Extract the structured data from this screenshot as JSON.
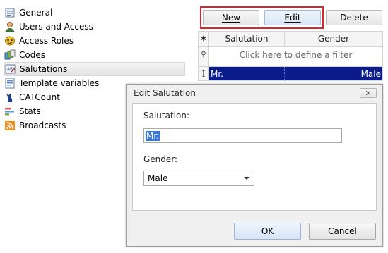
{
  "sidebar": {
    "items": [
      {
        "label": "General",
        "icon": "general-icon"
      },
      {
        "label": "Users and Access",
        "icon": "user-icon"
      },
      {
        "label": "Access Roles",
        "icon": "mask-icon"
      },
      {
        "label": "Codes",
        "icon": "codes-icon"
      },
      {
        "label": "Salutations",
        "icon": "salutation-icon",
        "selected": true
      },
      {
        "label": "Template variables",
        "icon": "template-icon"
      },
      {
        "label": "CATCount",
        "icon": "cat-icon"
      },
      {
        "label": "Stats",
        "icon": "stats-icon"
      },
      {
        "label": "Broadcasts",
        "icon": "rss-icon"
      }
    ]
  },
  "toolbar": {
    "new_label": "New",
    "edit_label": "Edit",
    "delete_label": "Delete"
  },
  "grid": {
    "columns": [
      "Salutation",
      "Gender"
    ],
    "filter_text": "Click here to define a filter",
    "rows": [
      {
        "salutation": "Mr.",
        "gender": "Male"
      }
    ],
    "header_indicator": "✱",
    "filter_indicator": "⚲",
    "row_indicator": "I"
  },
  "dialog": {
    "title": "Edit Salutation",
    "close_glyph": "✕",
    "salutation_label": "Salutation:",
    "salutation_value": "Mr.",
    "gender_label": "Gender:",
    "gender_value": "Male",
    "ok_label": "OK",
    "cancel_label": "Cancel"
  },
  "colors": {
    "accent_highlight": "#d9262d",
    "selected_row": "#0a1b8a",
    "text_selection": "#3a78d6"
  }
}
